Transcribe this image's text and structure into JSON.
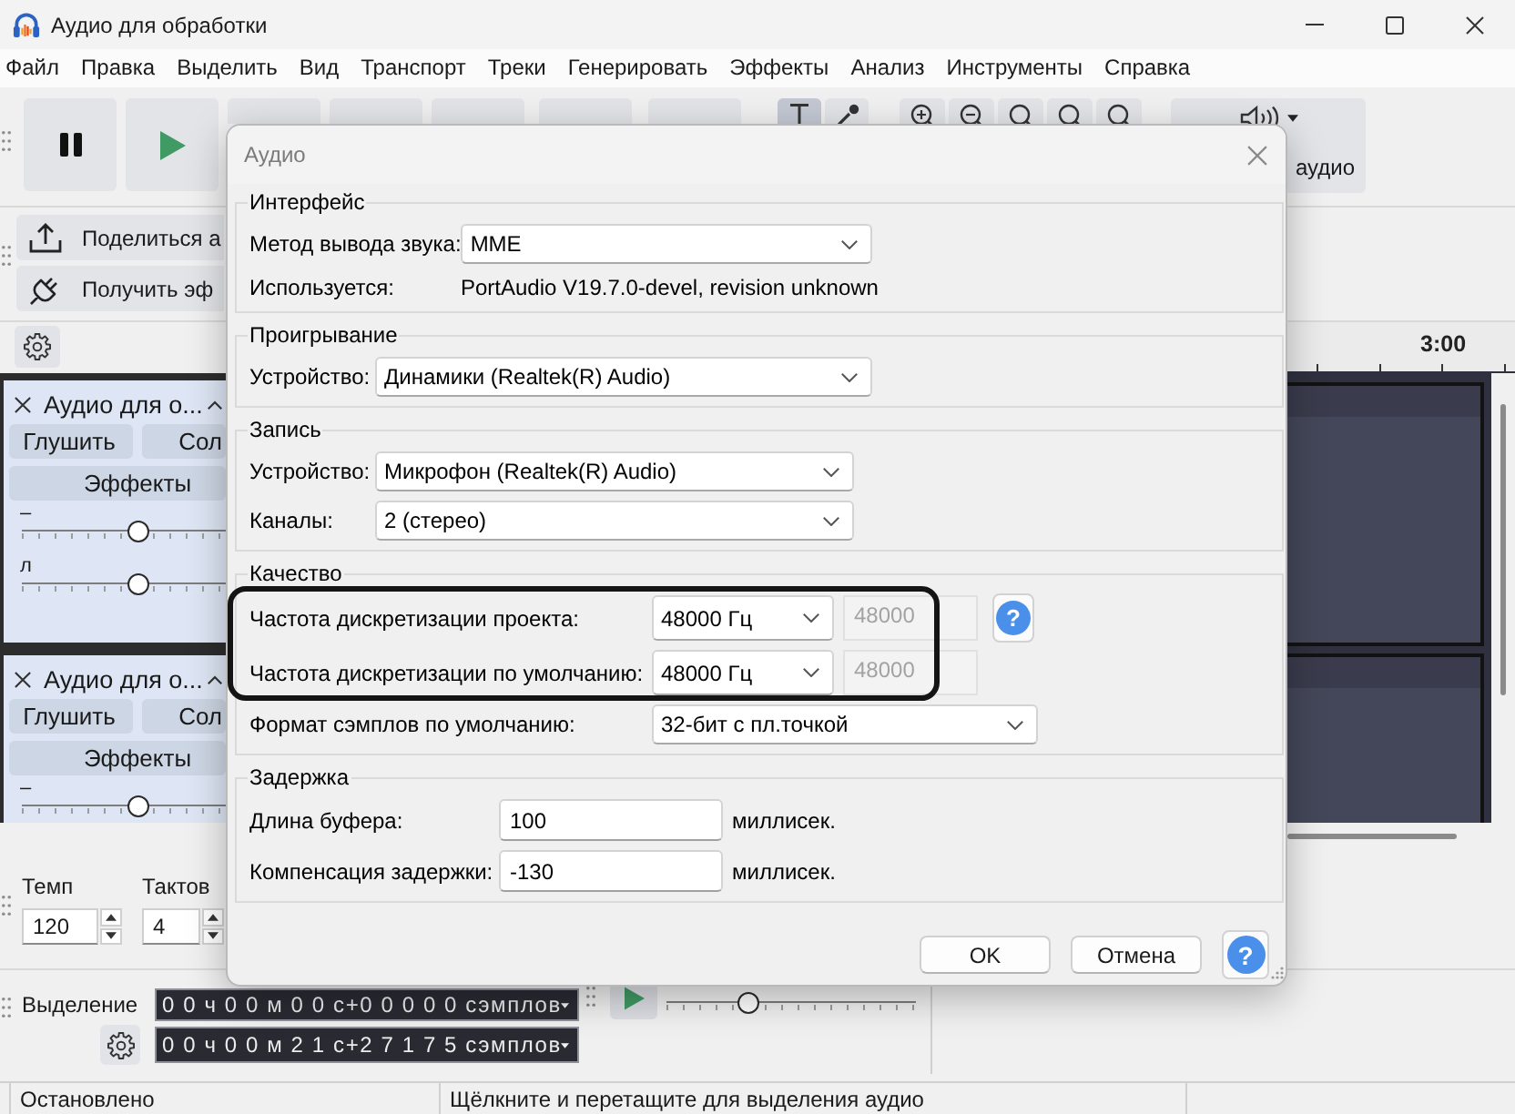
{
  "window": {
    "title": "Аудио для обработки"
  },
  "menu": [
    "Файл",
    "Правка",
    "Выделить",
    "Вид",
    "Транспорт",
    "Треки",
    "Генерировать",
    "Эффекты",
    "Анализ",
    "Инструменты",
    "Справка"
  ],
  "tools": [
    {
      "selected": true
    },
    {
      "selected": false
    }
  ],
  "audio_setup": {
    "label": "аудио"
  },
  "share_toolbar": [
    {
      "label": "Поделиться а"
    },
    {
      "label": "Получить эф"
    }
  ],
  "ruler": {
    "label": "3:00"
  },
  "tracks": [
    {
      "name": "Аудио для о...",
      "mute": "Глушить",
      "solo": "Сол",
      "effects": "Эффекты",
      "sliders": [
        {
          "label": "–",
          "level": 0.57
        },
        {
          "label": "л",
          "level": 0.57
        }
      ]
    },
    {
      "name": "Аудио для о...",
      "mute": "Глушить",
      "solo": "Сол",
      "effects": "Эффекты",
      "sliders": [
        {
          "label": "–",
          "level": 0.57
        }
      ]
    }
  ],
  "time_signature": {
    "tempo_label": "Темп",
    "tempo": "120",
    "beats_label": "Тактов",
    "beats": "4"
  },
  "selection": {
    "label": "Выделение",
    "start": "0 0 ч 0 0 м 0 0 с+0 0 0 0 0 сэмплов",
    "end": "0 0 ч 0 0 м 2 1 с+2 7 1 7 5 сэмплов"
  },
  "play_at_speed": {
    "level": 0.33
  },
  "status_bar": [
    "Остановлено",
    "Щёлкните и перетащите для выделения аудио"
  ],
  "dialog": {
    "title": "Аудио",
    "groups": [
      {
        "title": "Интерфейс",
        "rows": [
          {
            "kind": "dropdown",
            "label": "Метод вывода звука:",
            "value": "MME"
          },
          {
            "kind": "info",
            "label": "Используется:",
            "value": "PortAudio V19.7.0-devel, revision unknown"
          }
        ]
      },
      {
        "title": "Проигрывание",
        "rows": [
          {
            "kind": "dropdown",
            "label": "Устройство:",
            "value": "Динамики (Realtek(R) Audio)"
          }
        ]
      },
      {
        "title": "Запись",
        "rows": [
          {
            "kind": "dropdown",
            "label": "Устройство:",
            "value": "Микрофон (Realtek(R) Audio)"
          },
          {
            "kind": "dropdown",
            "label": "Каналы:",
            "value": "2 (стерео)"
          }
        ]
      },
      {
        "title": "Качество",
        "rows": [
          {
            "kind": "rate",
            "label": "Частота дискретизации проекта:",
            "value": "48000 Гц",
            "custom": {
              "value": "48000",
              "disabled": true
            },
            "help": "?",
            "highlighted": true
          },
          {
            "kind": "rate",
            "label": "Частота дискретизации по умолчанию:",
            "value": "48000 Гц",
            "custom": {
              "value": "48000",
              "disabled": true
            },
            "highlighted": true
          },
          {
            "kind": "dropdown",
            "label": "Формат сэмплов по умолчанию:",
            "value": "32-бит с пл.точкой",
            "highlighted": false
          }
        ]
      },
      {
        "title": "Задержка",
        "rows": [
          {
            "kind": "input",
            "label": "Длина буфера:",
            "value": "100",
            "unit": "миллисек."
          },
          {
            "kind": "input",
            "label": "Компенсация задержки:",
            "value": "-130",
            "unit": "миллисек."
          }
        ]
      }
    ],
    "buttons": [
      {
        "label": "OK"
      },
      {
        "label": "Отмена"
      }
    ],
    "help": "?"
  }
}
